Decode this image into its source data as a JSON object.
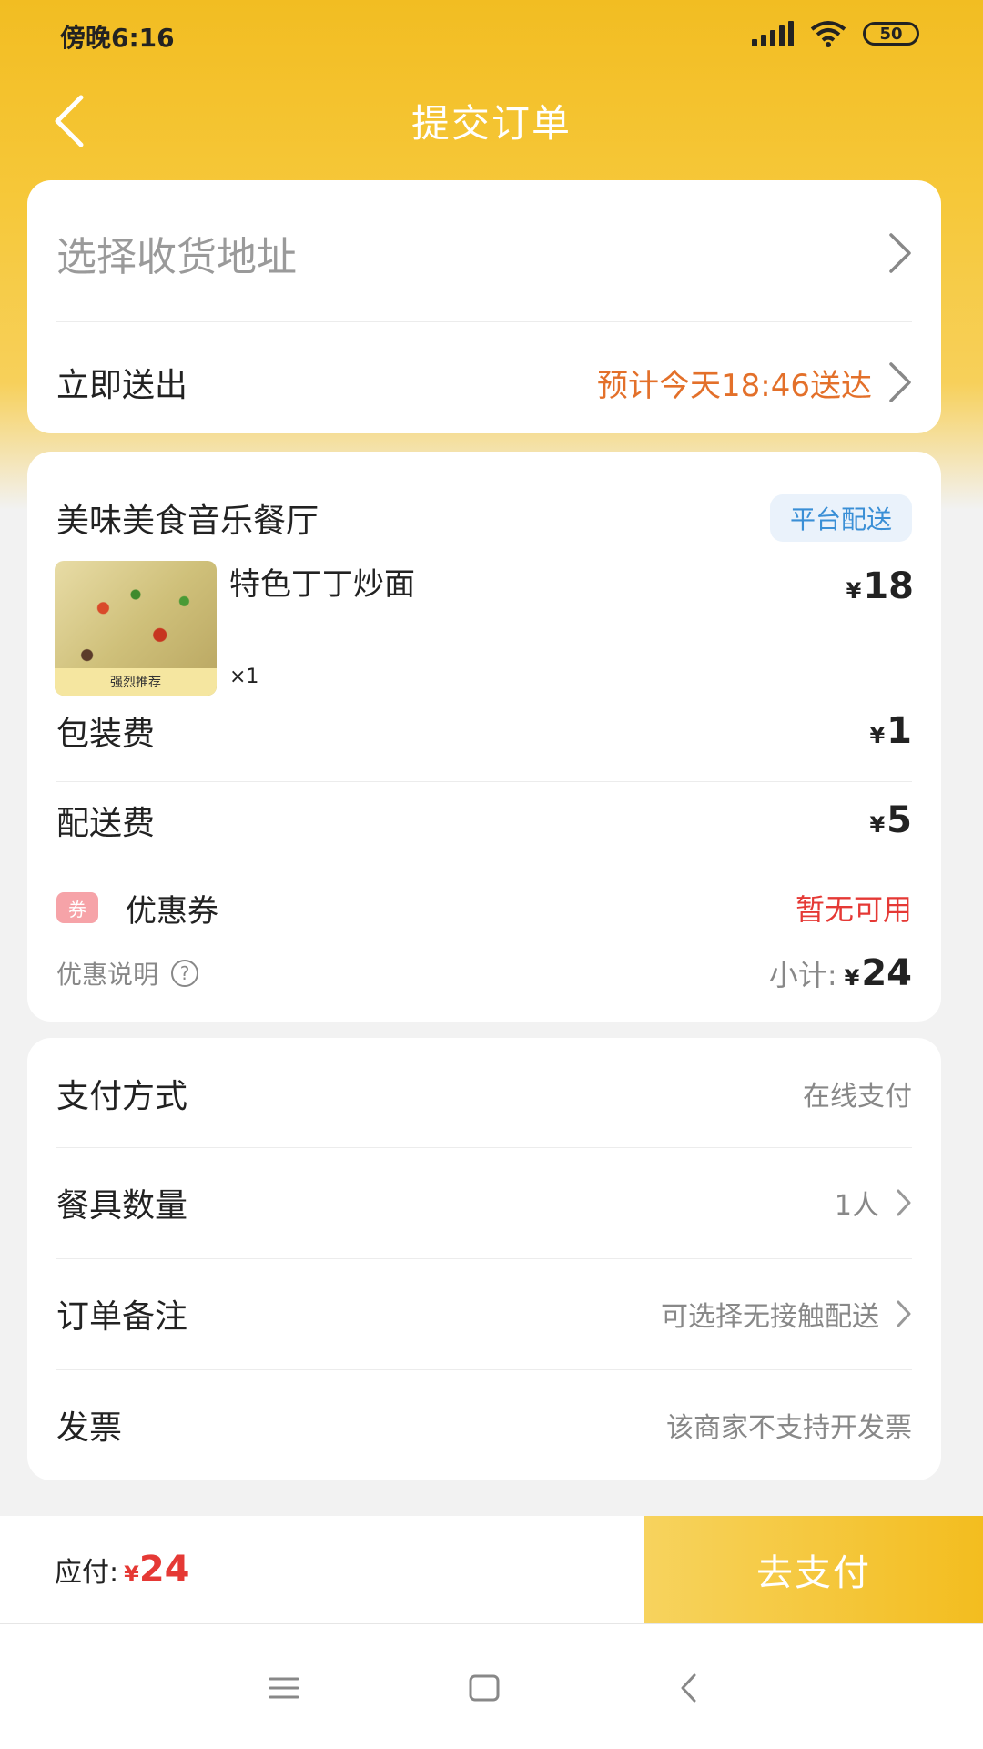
{
  "status": {
    "time": "傍晚6:16",
    "battery": "50"
  },
  "header": {
    "title": "提交订单"
  },
  "delivery": {
    "address_placeholder": "选择收货地址",
    "mode_label": "立即送出",
    "eta": "预计今天18:46送达"
  },
  "order": {
    "shop_name": "美味美食音乐餐厅",
    "delivery_badge": "平台配送",
    "item": {
      "name": "特色丁丁炒面",
      "qty": "×1",
      "price": "18",
      "thumb_label": "强烈推荐"
    },
    "packaging_label": "包装费",
    "packaging_price": "1",
    "delivery_fee_label": "配送费",
    "delivery_fee_price": "5",
    "coupon_icon": "券",
    "coupon_label": "优惠券",
    "coupon_status": "暂无可用",
    "discount_desc_label": "优惠说明",
    "subtotal_label": "小计:",
    "subtotal": "24",
    "currency": "¥"
  },
  "options": {
    "payment_label": "支付方式",
    "payment_value": "在线支付",
    "tableware_label": "餐具数量",
    "tableware_value": "1人",
    "note_label": "订单备注",
    "note_value": "可选择无接触配送",
    "invoice_label": "发票",
    "invoice_value": "该商家不支持开发票"
  },
  "footer": {
    "payable_label": "应付:",
    "payable_amount": "24",
    "currency": "¥",
    "pay_button": "去支付"
  },
  "colors": {
    "brand": "#f3bd1f",
    "price_red": "#e53935",
    "eta_orange": "#e3702a",
    "badge_blue": "#3a8fd6"
  },
  "icons": [
    "back-arrow-icon",
    "chevron-right-icon",
    "coupon-icon",
    "help-icon",
    "menu-icon",
    "home-icon",
    "back-nav-icon",
    "signal-icon",
    "wifi-icon",
    "battery-icon"
  ]
}
